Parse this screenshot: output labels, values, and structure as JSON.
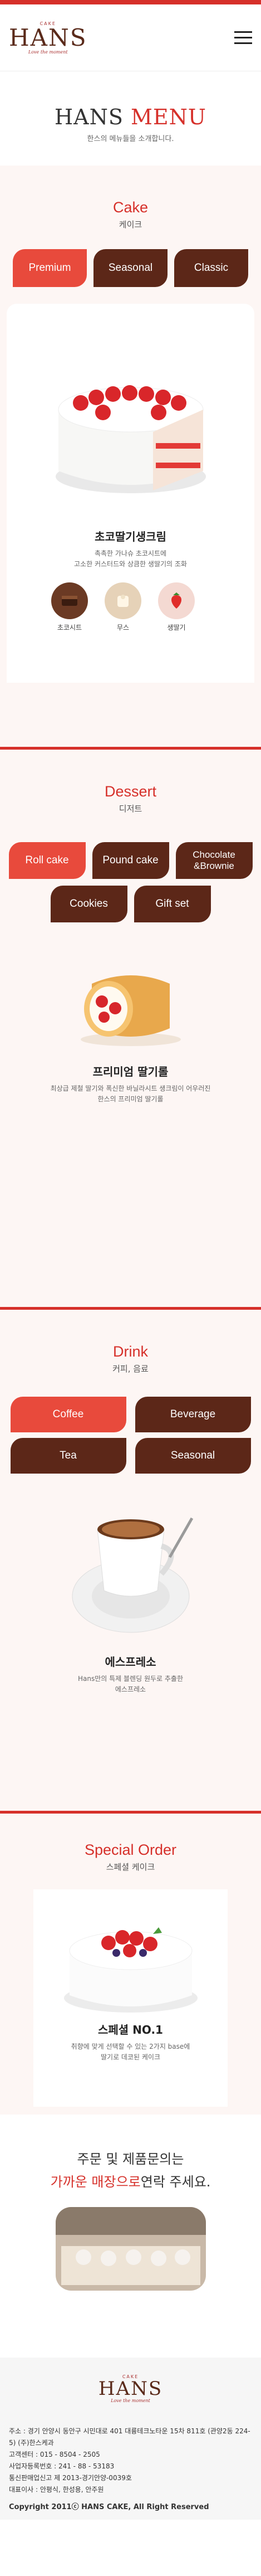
{
  "brand": {
    "small": "CAKE",
    "name": "HANS",
    "tagline": "Love the moment"
  },
  "hero": {
    "title_main": "HANS",
    "title_accent": "MENU",
    "subtitle": "한스의 메뉴들을 소개합니다."
  },
  "cake": {
    "title_en": "Cake",
    "title_ko": "케이크",
    "tabs": [
      "Premium",
      "Seasonal",
      "Classic"
    ],
    "product_name": "초코딸기생크림",
    "product_desc_1": "촉촉한 가나슈 초코시트에",
    "product_desc_2": "고소한 커스터드와 상큼한 생딸기의 조화",
    "icons": [
      {
        "label": "초코시트",
        "icon": "chocolate-sheet-icon"
      },
      {
        "label": "무스",
        "icon": "mousse-icon"
      },
      {
        "label": "생딸기",
        "icon": "strawberry-icon"
      }
    ]
  },
  "dessert": {
    "title_en": "Dessert",
    "title_ko": "디저트",
    "tabs": [
      "Roll cake",
      "Pound cake",
      "Chocolate &Brownie",
      "Cookies",
      "Gift set"
    ],
    "product_name": "프리미엄 딸기롤",
    "product_desc_1": "최상급 제철 딸기와 폭신한 바닐라시트 생크림이 어우러진",
    "product_desc_2": "한스의 프리미엄 딸기롤"
  },
  "drink": {
    "title_en": "Drink",
    "title_ko": "커피, 음료",
    "tabs": [
      "Coffee",
      "Beverage",
      "Tea",
      "Seasonal"
    ],
    "product_name": "에스프레소",
    "product_desc_1": "Hans만의 특제 블렌딩 원두로 추출한",
    "product_desc_2": "에스프레소"
  },
  "special": {
    "title_en": "Special Order",
    "title_ko": "스페셜 케이크",
    "product_name": "스페셜 NO.1",
    "product_desc_1": "취향에 맞게 선택할 수 있는 2가지 base에",
    "product_desc_2": "딸기로 데코된 케이크"
  },
  "contact": {
    "line1": "주문 및 제품문의는",
    "line2_accent": "가까운 매장으로",
    "line2_rest": "연락 주세요."
  },
  "footer": {
    "address": "주소 : 경기 안양시 동안구 시민대로 401 대륭테크노타운 15차 811호 (관양2동 224-5) (주)한스케과",
    "phone": "고객센터 : 015 - 8504 - 2505",
    "biz_no": "사업자등록번호 : 241 - 88 - 53183",
    "mail_order": "통신판매업신고 제 2013-경기안양-0039호",
    "ceo": "대표이사 : 안평식, 한성용, 안주원",
    "copyright": "Copyright 2011ⓒ HANS CAKE, All Right Reserved"
  },
  "colors": {
    "accent": "#d6302a",
    "brown": "#5c2718",
    "pill_red": "#e84a3c",
    "section_bg": "#fdf6f4"
  }
}
